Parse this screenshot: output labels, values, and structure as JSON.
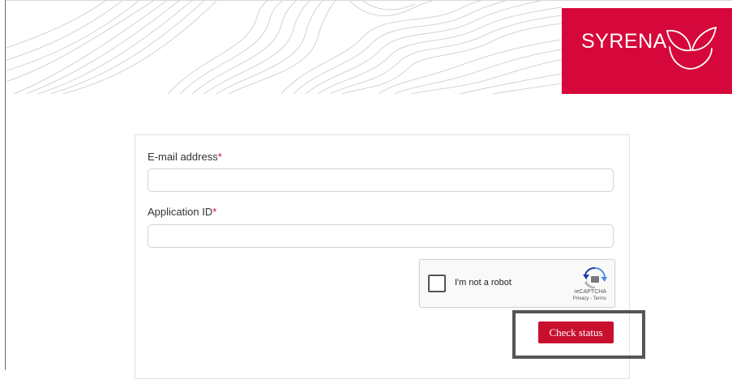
{
  "brand": {
    "name": "SYRENA",
    "color": "#d6083b"
  },
  "form": {
    "email_label": "E-mail address",
    "application_id_label": "Application ID",
    "required_marker": "*",
    "email_value": "",
    "application_id_value": ""
  },
  "recaptcha": {
    "label": "I'm not a robot",
    "brand": "reCAPTCHA",
    "links": "Privacy - Terms"
  },
  "actions": {
    "check_status_label": "Check status",
    "button_color": "#c8102e"
  },
  "icons": {
    "logo_mark": "syrena-leaf-logo-icon",
    "recaptcha": "recaptcha-logo-icon"
  }
}
